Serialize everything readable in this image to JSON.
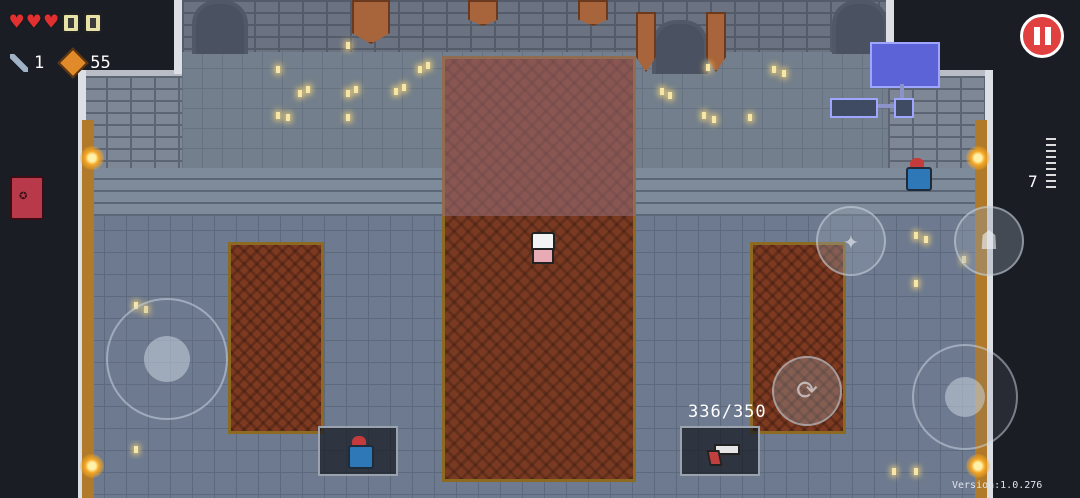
{
  "hud": {
    "hearts": 3,
    "shields": 2,
    "keys": "1",
    "gems": "55",
    "ammo_count": "7",
    "energy": "336/350",
    "version": "Version:1.0.276"
  },
  "icons": {
    "pause": "pause-icon",
    "book": "book-icon",
    "weapon": "pistol-icon",
    "key": "key-icon",
    "gem": "gem-icon"
  },
  "colors": {
    "heart": "#e23030",
    "pause_button": "#e04040",
    "minimap_room": "#5b63d6",
    "carpet": "#7a3a22"
  }
}
